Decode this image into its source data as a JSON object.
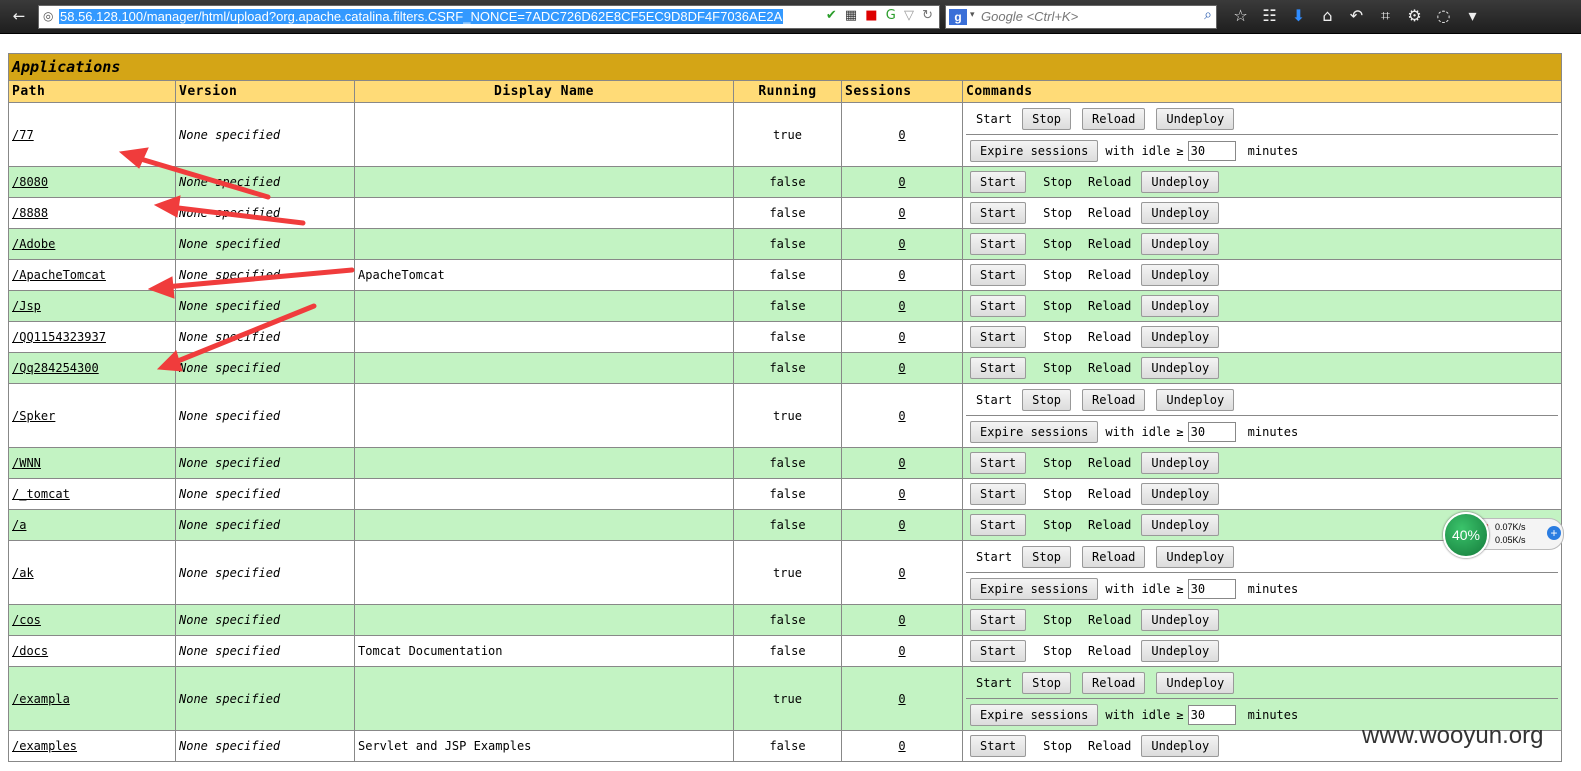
{
  "browser": {
    "url": "58.56.128.100/manager/html/upload?org.apache.catalina.filters.CSRF_NONCE=7ADC726D62E8CF5EC9D8DF4F7036AE2A",
    "search_placeholder": "Google <Ctrl+K>",
    "search_engine_icon": "google-icon"
  },
  "apps": {
    "title": "Applications",
    "headers": {
      "path": "Path",
      "version": "Version",
      "display_name": "Display Name",
      "running": "Running",
      "sessions": "Sessions",
      "commands": "Commands"
    },
    "commands": {
      "start": "Start",
      "stop": "Stop",
      "reload": "Reload",
      "undeploy": "Undeploy",
      "expire": "Expire sessions",
      "with_idle": "with idle",
      "ge": "≥",
      "idle_value": "30",
      "minutes": "minutes"
    },
    "rows": [
      {
        "path": "/77",
        "version": "None specified",
        "display_name": "",
        "running": "true",
        "sessions": "0"
      },
      {
        "path": "/8080",
        "version": "None specified",
        "display_name": "",
        "running": "false",
        "sessions": "0"
      },
      {
        "path": "/8888",
        "version": "None specified",
        "display_name": "",
        "running": "false",
        "sessions": "0"
      },
      {
        "path": "/Adobe",
        "version": "None specified",
        "display_name": "",
        "running": "false",
        "sessions": "0"
      },
      {
        "path": "/ApacheTomcat",
        "version": "None specified",
        "display_name": "ApacheTomcat",
        "running": "false",
        "sessions": "0"
      },
      {
        "path": "/Jsp",
        "version": "None specified",
        "display_name": "",
        "running": "false",
        "sessions": "0"
      },
      {
        "path": "/QQ1154323937",
        "version": "None specified",
        "display_name": "",
        "running": "false",
        "sessions": "0"
      },
      {
        "path": "/Qq284254300",
        "version": "None specified",
        "display_name": "",
        "running": "false",
        "sessions": "0"
      },
      {
        "path": "/Spker",
        "version": "None specified",
        "display_name": "",
        "running": "true",
        "sessions": "0"
      },
      {
        "path": "/WNN",
        "version": "None specified",
        "display_name": "",
        "running": "false",
        "sessions": "0"
      },
      {
        "path": "/_tomcat",
        "version": "None specified",
        "display_name": "",
        "running": "false",
        "sessions": "0"
      },
      {
        "path": "/a",
        "version": "None specified",
        "display_name": "",
        "running": "false",
        "sessions": "0"
      },
      {
        "path": "/ak",
        "version": "None specified",
        "display_name": "",
        "running": "true",
        "sessions": "0"
      },
      {
        "path": "/cos",
        "version": "None specified",
        "display_name": "",
        "running": "false",
        "sessions": "0"
      },
      {
        "path": "/docs",
        "version": "None specified",
        "display_name": "Tomcat Documentation",
        "running": "false",
        "sessions": "0"
      },
      {
        "path": "/exampla",
        "version": "None specified",
        "display_name": "",
        "running": "true",
        "sessions": "0"
      },
      {
        "path": "/examples",
        "version": "None specified",
        "display_name": "Servlet and JSP Examples",
        "running": "false",
        "sessions": "0"
      }
    ]
  },
  "speed_widget": {
    "percent": "40%",
    "up": "0.07K/s",
    "down": "0.05K/s"
  },
  "watermark": "www.wooyun.org",
  "colors": {
    "title_bg": "#d4a516",
    "header_bg": "#ffdb77",
    "even_row_bg": "#c3f3c3",
    "annotation_arrow": "#f03c3c"
  }
}
